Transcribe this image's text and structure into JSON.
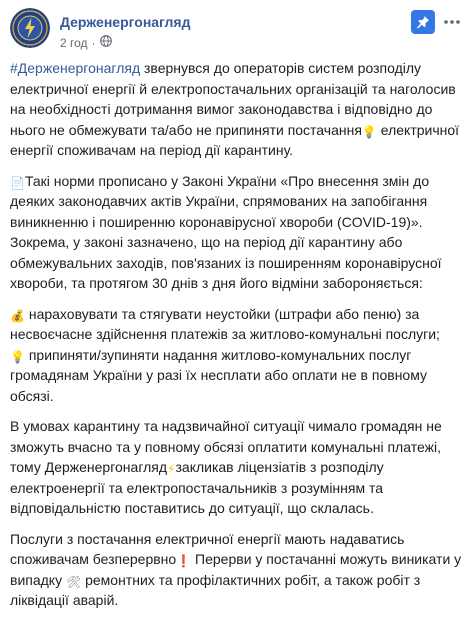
{
  "post": {
    "page_name": "Держенергонагляд",
    "time": "2 год",
    "icons": {
      "avatar": "derzhenergonagliad-logo",
      "audience": "globe-icon",
      "pin": "pin-icon",
      "more": "more-icon"
    },
    "colors": {
      "link": "#385898",
      "meta": "#616770",
      "pin_bg": "#3578e5",
      "text": "#1c1e21"
    },
    "p1": {
      "hashtag": "#Держенергонагляд",
      "t1": " звернувся до операторів систем розподілу електричної енергії й електропостачальних організацій та наголосив на необхідності дотримання вимог законодавства і відповідно до нього не обмежувати та/або не припиняти постачання",
      "t2": " електричної енергії споживачам на період дії карантину."
    },
    "p2": {
      "t1": "Такі норми прописано у Законі України «Про внесення змін до деяких законодавчих актів України, спрямованих на запобігання виникненню і поширенню коронавірусної хвороби (COVID-19)». Зокрема, у законі зазначено, що на період дії карантину або обмежувальних заходів, пов'язаних із поширенням коронавірусної хвороби, та протягом 30 днів з дня його відміни забороняється:"
    },
    "p3": {
      "t1": "нараховувати та стягувати неустойки (штрафи або пеню) за несвоєчасне здійснення платежів за житлово-комунальні послуги;",
      "t2": "припиняти/зупиняти надання житлово-комунальних послуг громадянам України у разі їх несплати або оплати не в повному обсязі."
    },
    "p4": {
      "t1": "В умовах карантину та надзвичайної ситуації чимало громадян не зможуть вчасно та у повному обсязі оплатити комунальні платежі, тому Держенергонагляд",
      "t2": "закликав ліцензіатів з розподілу електроенергії та електропостачальників з розумінням та відповідальністю поставитись до ситуації, що склалась."
    },
    "p5": {
      "t1": "Послуги з постачання електричної енергії мають надаватись споживачам безперервно",
      "t2": " Перерви у постачанні можуть виникати у випадку",
      "t3": " ремонтних та профілактичних робіт, а також робіт з ліквідації аварій."
    }
  }
}
